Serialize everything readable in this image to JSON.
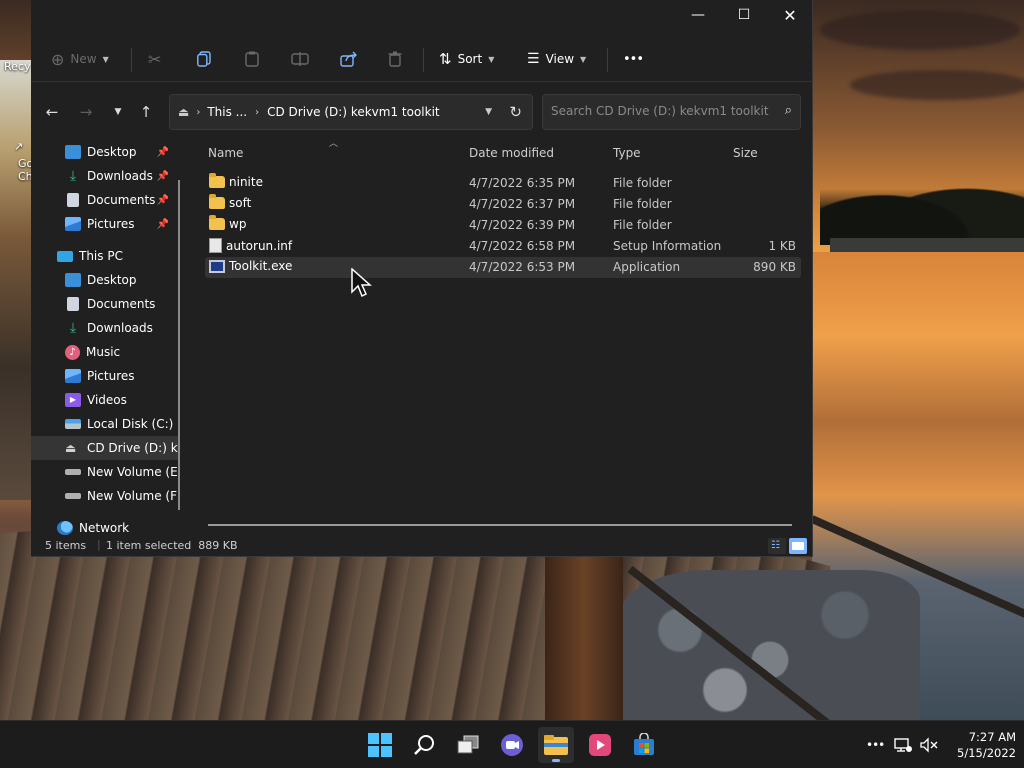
{
  "desktop": {
    "icons": [
      {
        "label": "Recy"
      },
      {
        "label": "Go"
      },
      {
        "label": "Ch"
      }
    ]
  },
  "window": {
    "controls": {
      "minimize": "—",
      "maximize": "☐",
      "close": "✕"
    },
    "command_bar": {
      "new_label": "New",
      "sort_label": "Sort",
      "view_label": "View",
      "more_label": "•••"
    },
    "address": {
      "segment1": "This ...",
      "segment2": "CD Drive (D:) kekvm1 toolkit"
    },
    "search": {
      "placeholder": "Search CD Drive (D:) kekvm1 toolkit"
    },
    "sidebar": {
      "quick_access": [
        {
          "label": "Desktop",
          "pinned": true,
          "color": "#3b8fd9"
        },
        {
          "label": "Downloads",
          "pinned": true,
          "color": "#3fb37f"
        },
        {
          "label": "Documents",
          "pinned": true,
          "color": "#cfd6df"
        },
        {
          "label": "Pictures",
          "pinned": true,
          "color": "#4a90e2"
        }
      ],
      "this_pc": "This PC",
      "this_pc_items": [
        {
          "label": "Desktop",
          "color": "#3b8fd9"
        },
        {
          "label": "Documents",
          "color": "#cfd6df"
        },
        {
          "label": "Downloads",
          "color": "#3fb37f"
        },
        {
          "label": "Music",
          "color": "#e0607e"
        },
        {
          "label": "Pictures",
          "color": "#4a90e2"
        },
        {
          "label": "Videos",
          "color": "#8a5be6"
        },
        {
          "label": "Local Disk (C:)",
          "color": "#b8c4cc"
        },
        {
          "label": "CD Drive (D:) ke",
          "color": "#d0d0d0"
        },
        {
          "label": "New Volume (E",
          "color": "#b0b0b0"
        },
        {
          "label": "New Volume (F",
          "color": "#b0b0b0"
        }
      ],
      "network": "Network"
    },
    "columns": {
      "name": "Name",
      "date": "Date modified",
      "type": "Type",
      "size": "Size"
    },
    "files": [
      {
        "name": "ninite",
        "date": "4/7/2022 6:35 PM",
        "type": "File folder",
        "size": "",
        "kind": "folder"
      },
      {
        "name": "soft",
        "date": "4/7/2022 6:37 PM",
        "type": "File folder",
        "size": "",
        "kind": "folder"
      },
      {
        "name": "wp",
        "date": "4/7/2022 6:39 PM",
        "type": "File folder",
        "size": "",
        "kind": "folder"
      },
      {
        "name": "autorun.inf",
        "date": "4/7/2022 6:58 PM",
        "type": "Setup Information",
        "size": "1 KB",
        "kind": "inf"
      },
      {
        "name": "Toolkit.exe",
        "date": "4/7/2022 6:53 PM",
        "type": "Application",
        "size": "890 KB",
        "kind": "exe"
      }
    ],
    "status": {
      "item_count": "5 items",
      "selection": "1 item selected  889 KB"
    }
  },
  "taskbar": {
    "more_icon": "•••",
    "time": "7:27 AM",
    "date": "5/15/2022"
  }
}
